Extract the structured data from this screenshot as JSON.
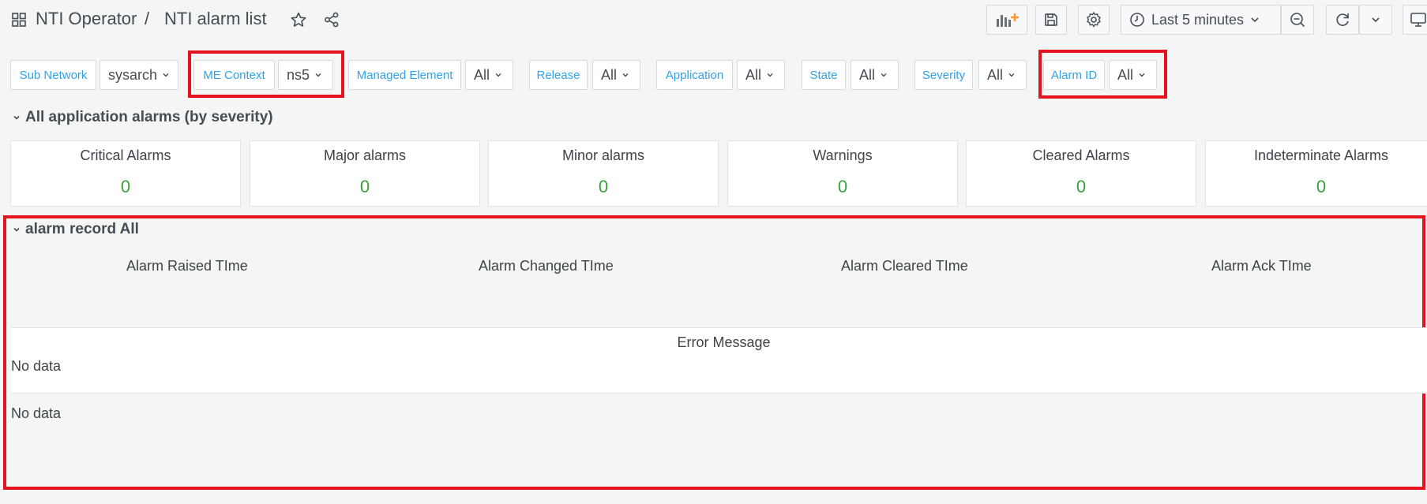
{
  "header": {
    "breadcrumb_folder": "NTI Operator",
    "breadcrumb_separator": "/",
    "breadcrumb_dashboard": "NTI alarm list",
    "time_range": "Last 5 minutes",
    "icons": [
      "apps-icon",
      "star-icon",
      "share-icon",
      "add-panel-icon",
      "save-icon",
      "settings-icon",
      "clock-icon",
      "chevron-down-icon",
      "zoom-out-icon",
      "refresh-icon",
      "chevron-down-icon",
      "tv-icon"
    ]
  },
  "variables": [
    {
      "label": "Sub Network",
      "value": "sysarch"
    },
    {
      "label": "ME Context",
      "value": "ns5"
    },
    {
      "label": "Managed Element",
      "value": "All"
    },
    {
      "label": "Release",
      "value": "All"
    },
    {
      "label": "Application",
      "value": "All"
    },
    {
      "label": "State",
      "value": "All"
    },
    {
      "label": "Severity",
      "value": "All"
    },
    {
      "label": "Alarm ID",
      "value": "All"
    }
  ],
  "row_severity": {
    "title": "All application alarms (by severity)",
    "stats": [
      {
        "title": "Critical Alarms",
        "value": "0"
      },
      {
        "title": "Major alarms",
        "value": "0"
      },
      {
        "title": "Minor alarms",
        "value": "0"
      },
      {
        "title": "Warnings",
        "value": "0"
      },
      {
        "title": "Cleared Alarms",
        "value": "0"
      },
      {
        "title": "Indeterminate Alarms",
        "value": "0"
      }
    ]
  },
  "row_record": {
    "title": "alarm record All",
    "columns": [
      "Alarm Raised TIme",
      "Alarm Changed TIme",
      "Alarm Cleared TIme",
      "Alarm Ack TIme"
    ],
    "error_panel_title": "Error Message",
    "no_data_1": "No data",
    "no_data_2": "No data"
  },
  "colors": {
    "highlight": "#e3141f",
    "variable_label": "#33a2e5",
    "stat_value": "#37a13b",
    "add_panel_accent": "#ff9830"
  }
}
